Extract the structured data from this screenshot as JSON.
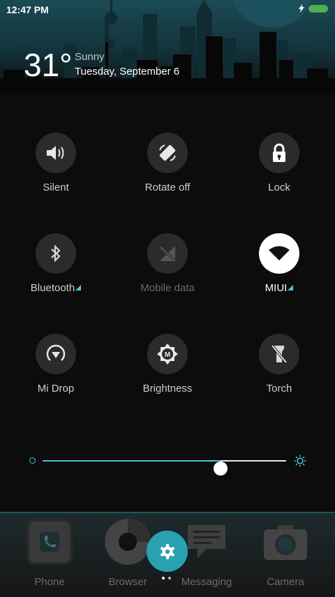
{
  "status_bar": {
    "time": "12:47 PM"
  },
  "weather": {
    "temperature": "31°",
    "condition": "Sunny",
    "date": "Tuesday, September 6"
  },
  "toggles": [
    {
      "id": "silent",
      "label": "Silent",
      "icon": "speaker-icon",
      "state": "off"
    },
    {
      "id": "rotate",
      "label": "Rotate off",
      "icon": "rotate-icon",
      "state": "off"
    },
    {
      "id": "lock",
      "label": "Lock",
      "icon": "lock-icon",
      "state": "off"
    },
    {
      "id": "bluetooth",
      "label": "Bluetooth",
      "icon": "bluetooth-icon",
      "state": "off"
    },
    {
      "id": "mobile_data",
      "label": "Mobile data",
      "icon": "mobile-data-off-icon",
      "state": "disabled"
    },
    {
      "id": "wifi",
      "label": "MIUI",
      "icon": "wifi-icon",
      "state": "on"
    },
    {
      "id": "midrop",
      "label": "Mi Drop",
      "icon": "midrop-icon",
      "state": "off"
    },
    {
      "id": "brightness",
      "label": "Brightness",
      "icon": "auto-brightness-icon",
      "state": "off"
    },
    {
      "id": "torch",
      "label": "Torch",
      "icon": "torch-icon",
      "state": "off"
    }
  ],
  "brightness_slider": {
    "value": 0.73
  },
  "dock": [
    {
      "label": "Phone",
      "icon": "phone-icon"
    },
    {
      "label": "Browser",
      "icon": "browser-icon"
    },
    {
      "label": "Messaging",
      "icon": "messaging-icon"
    },
    {
      "label": "Camera",
      "icon": "camera-icon"
    }
  ],
  "colors": {
    "accent": "#46c7d6",
    "fab": "#2aa1b1",
    "active_tile": "#ffffff",
    "tile": "#2b2b2b"
  }
}
